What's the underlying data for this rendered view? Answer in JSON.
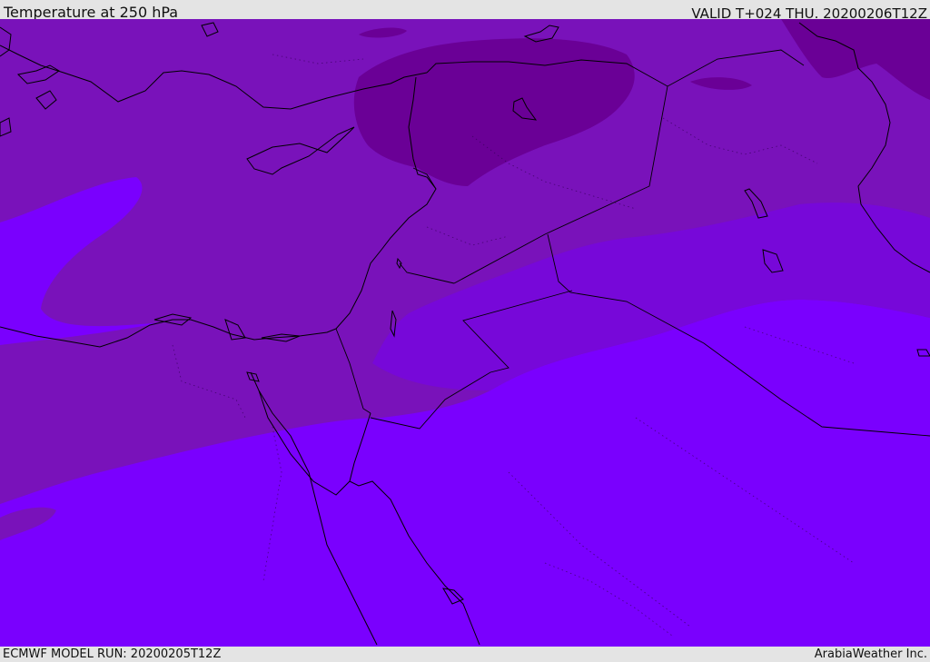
{
  "header": {
    "title": "Temperature at 250 hPa",
    "valid_time": "VALID T+024 THU. 20200206T12Z"
  },
  "footer": {
    "model_run": "ECMWF MODEL RUN: 20200205T12Z",
    "credit": "ArabiaWeather Inc."
  },
  "map": {
    "field": "Temperature at 250 hPa",
    "colors": {
      "warm_band": "#7a00fe",
      "mid_band": "#7912ba",
      "cool_band": "#6a0096",
      "coastline": "#000000",
      "grid_dotted": "#3a0060"
    }
  }
}
